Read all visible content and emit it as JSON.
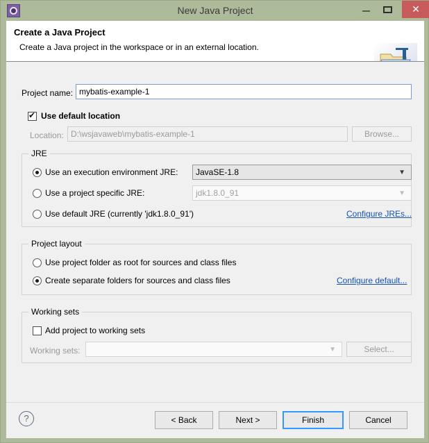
{
  "window": {
    "title": "New Java Project",
    "icon": "eclipse-gear-icon",
    "controls": {
      "minimize": "–",
      "maximize": "□",
      "close": "✕"
    },
    "frame_color": "#aebb9a",
    "close_color": "#c75b5b"
  },
  "banner": {
    "title": "Create a Java Project",
    "subtitle": "Create a Java project in the workspace or in an external location.",
    "icon": "java-project-folder-icon"
  },
  "project": {
    "name_label": "Project name:",
    "name_value": "mybatis-example-1",
    "use_default_location_label": "Use default location",
    "use_default_location_checked": true,
    "location_label": "Location:",
    "location_value": "D:\\wsjavaweb\\mybatis-example-1",
    "browse_label": "Browse..."
  },
  "jre": {
    "group_title": "JRE",
    "options": [
      {
        "label": "Use an execution environment JRE:",
        "selected": true
      },
      {
        "label": "Use a project specific JRE:",
        "selected": false
      },
      {
        "label": "Use default JRE (currently 'jdk1.8.0_91')",
        "selected": false
      }
    ],
    "execution_env_value": "JavaSE-1.8",
    "specific_jre_value": "jdk1.8.0_91",
    "configure_link": "Configure JREs..."
  },
  "layout": {
    "group_title": "Project layout",
    "options": [
      {
        "label": "Use project folder as root for sources and class files",
        "selected": false
      },
      {
        "label": "Create separate folders for sources and class files",
        "selected": true
      }
    ],
    "configure_link": "Configure default..."
  },
  "working_sets": {
    "group_title": "Working sets",
    "add_label": "Add project to working sets",
    "add_checked": false,
    "sets_label": "Working sets:",
    "sets_value": "",
    "select_label": "Select..."
  },
  "footer": {
    "help_icon": "?",
    "back_label": "< Back",
    "next_label": "Next >",
    "finish_label": "Finish",
    "cancel_label": "Cancel",
    "default_button": "Finish"
  }
}
